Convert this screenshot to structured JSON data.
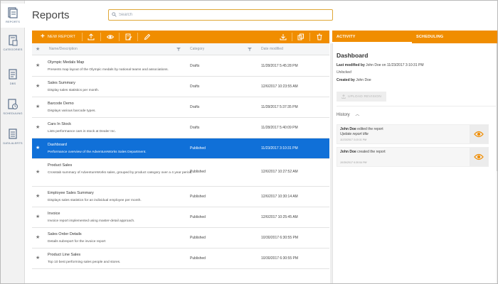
{
  "app": {
    "title": "Reports"
  },
  "leftnav": {
    "items": [
      {
        "label": "REPORTS",
        "icon": "reports-icon",
        "active": true
      },
      {
        "label": "CATEGORIES",
        "icon": "categories-icon",
        "active": false
      },
      {
        "label": "DBS",
        "icon": "dbs-icon",
        "active": false
      },
      {
        "label": "SCHEDULING",
        "icon": "scheduling-icon",
        "active": false
      },
      {
        "label": "DATA ALERTS",
        "icon": "data-alerts-icon",
        "active": false
      }
    ]
  },
  "search": {
    "placeholder": "Search",
    "value": ""
  },
  "toolbar": {
    "new_report_label": "NEW REPORT",
    "icons": [
      "upload-icon",
      "view-icon",
      "edit-document-icon",
      "pencil-icon",
      "download-icon",
      "copy-icon",
      "delete-icon"
    ]
  },
  "table": {
    "columns": {
      "name": "Name/Description",
      "category": "Category",
      "date": "Date modified"
    },
    "rows": [
      {
        "name": "Olympic Medals Map",
        "desc": "Presents map layout of the Olympic medals by national teams and associations.",
        "category": "Drafts",
        "date": "11/28/2017 5:45:28 PM"
      },
      {
        "name": "Sales Summary",
        "desc": "Display sales statistics per month.",
        "category": "Drafts",
        "date": "12/6/2017 10:23:55 AM"
      },
      {
        "name": "Barcode Demo",
        "desc": "Displays various barcode types.",
        "category": "Drafts",
        "date": "11/28/2017 5:37:35 PM"
      },
      {
        "name": "Cars In Stock",
        "desc": "Lists performance cars in stock at Dealer Inc.",
        "category": "Drafts",
        "date": "11/28/2017 5:40:09 PM"
      },
      {
        "name": "Dashboard",
        "desc": "Performance overview of the AdventureWorks Sales Department.",
        "category": "Published",
        "date": "11/23/2017 3:10:31 PM",
        "selected": true
      },
      {
        "name": "Product Sales",
        "desc": "Crosstab summary of AdventureWorks sales, grouped by product category over a 4 year period.",
        "category": "Published",
        "date": "12/6/2017 10:27:52 AM",
        "tall": true
      },
      {
        "name": "Employee Sales Summary",
        "desc": "Displays sales statistics for an individual employee per month.",
        "category": "Published",
        "date": "12/6/2017 10:30:14 AM"
      },
      {
        "name": "Invoice",
        "desc": "Invoice report implemented using master-detail approach.",
        "category": "Published",
        "date": "12/6/2017 10:25:45 AM"
      },
      {
        "name": "Sales Order Details",
        "desc": "Details subreport for the invoice report",
        "category": "Published",
        "date": "10/30/2017 6:30:55 PM"
      },
      {
        "name": "Product Line Sales",
        "desc": "Top 10 best performing sales people and stores.",
        "category": "Published",
        "date": "10/30/2017 6:30:55 PM"
      }
    ]
  },
  "panel": {
    "tabs": [
      {
        "label": "ACTIVITY"
      },
      {
        "label": "SCHEDULING"
      }
    ],
    "title": "Dashboard",
    "last_modified_label": "Last modified by",
    "last_modified_value": "John Doe on 11/23/2017 3:10:31 PM",
    "lock_status": "Unlocked",
    "created_by_label": "Created by",
    "created_by_value": "John Doe",
    "upload_revision_label": "UPLOAD REVISION",
    "history_label": "History",
    "history": [
      {
        "user": "John Doe",
        "action": "edited the report",
        "detail": "Update report title",
        "timestamp": "11/23/2017 3:10:31 PM"
      },
      {
        "user": "John Doe",
        "action": "created the report",
        "detail": "",
        "timestamp": "10/30/2017 6:30:54 PM"
      }
    ]
  },
  "colors": {
    "accent": "#f08d00",
    "selected": "#1070d8",
    "nav_text": "#5a6f8a"
  }
}
